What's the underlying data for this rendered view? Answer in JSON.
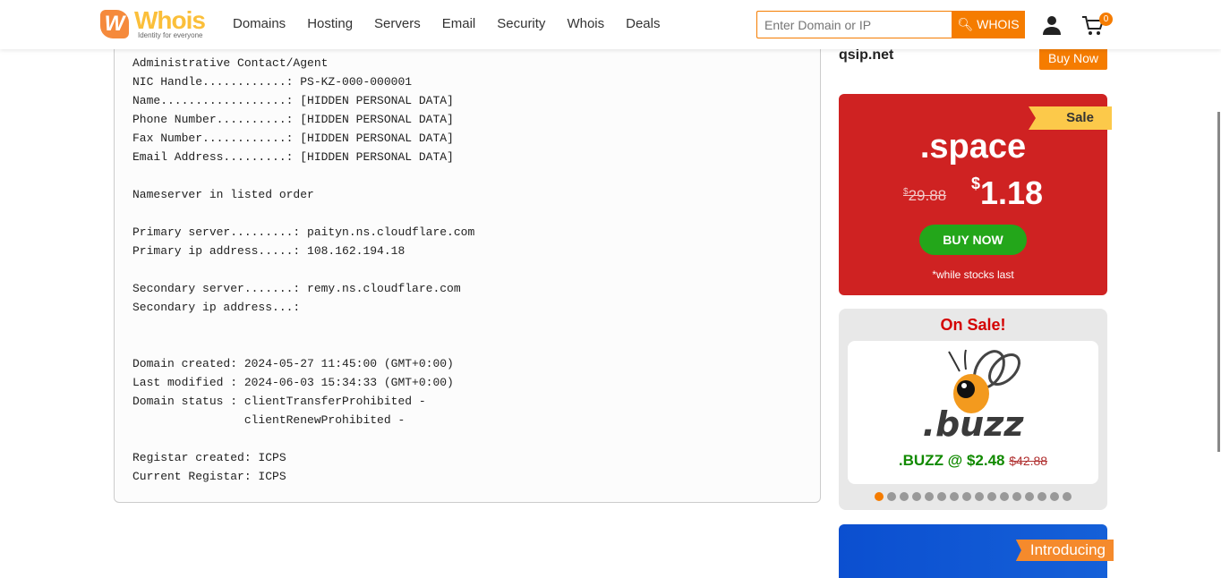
{
  "header": {
    "logo_text": "Whois",
    "logo_tagline": "Identity for everyone",
    "nav": [
      "Domains",
      "Hosting",
      "Servers",
      "Email",
      "Security",
      "Whois",
      "Deals"
    ],
    "search_placeholder": "Enter Domain or IP",
    "search_button": "WHOIS",
    "cart_count": "0"
  },
  "record": {
    "lines": [
      "Administrative Contact/Agent",
      "NIC Handle............: PS-KZ-000-000001",
      "Name..................: [HIDDEN PERSONAL DATA]",
      "Phone Number..........: [HIDDEN PERSONAL DATA]",
      "Fax Number............: [HIDDEN PERSONAL DATA]",
      "Email Address.........: [HIDDEN PERSONAL DATA]",
      "",
      "Nameserver in listed order",
      "",
      "Primary server.........: paityn.ns.cloudflare.com",
      "Primary ip address.....: 108.162.194.18",
      "",
      "Secondary server.......: remy.ns.cloudflare.com",
      "Secondary ip address...:",
      "",
      "",
      "Domain created: 2024-05-27 11:45:00 (GMT+0:00)",
      "Last modified : 2024-06-03 15:34:33 (GMT+0:00)",
      "Domain status : clientTransferProhibited -",
      "                clientRenewProhibited -",
      "",
      "Registar created: ICPS",
      "Current Registar: ICPS"
    ]
  },
  "sidebar": {
    "domain": "qsip.net",
    "buy_now": "Buy Now",
    "promo": {
      "ribbon": "Sale",
      "tld": ".space",
      "currency": "$",
      "old_price": "29.88",
      "new_price": "1.18",
      "button": "BUY NOW",
      "note": "*while stocks last"
    },
    "sale": {
      "title": "On Sale!",
      "logo": ".buzz",
      "offer": ".BUZZ @ $2.48",
      "old_price": "$42.88",
      "slide_count": 16,
      "active_slide": 1
    },
    "intro": {
      "ribbon": "Introducing"
    }
  },
  "colors": {
    "accent": "#f57c00",
    "promo_red": "#cf2222",
    "green": "#23a61a"
  }
}
